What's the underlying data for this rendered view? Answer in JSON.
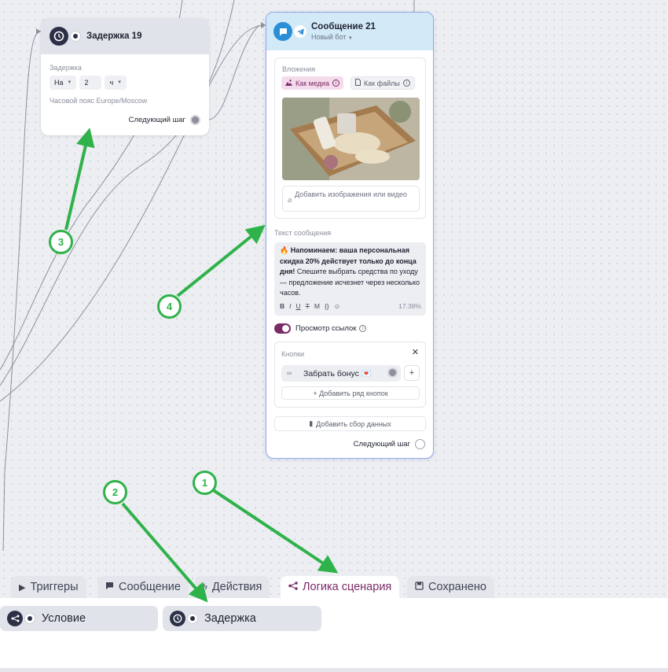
{
  "delay_node": {
    "title": "Задержка 19",
    "label": "Задержка",
    "select_mode": "На",
    "amount": "2",
    "unit": "ч",
    "timezone": "Часовой пояс Europe/Moscow",
    "next_step": "Следующий шаг"
  },
  "message_node": {
    "title": "Сообщение 21",
    "bot": "Новый бот",
    "attachments_label": "Вложения",
    "as_media": "Как медиа",
    "as_files": "Как файлы",
    "add_media": "Добавить изображения или видео",
    "text_label": "Текст сообщения",
    "text_emoji": "🔥",
    "text_bold": "Напоминаем: ваша персональная скидка 20% действует только до конца дня!",
    "text_rest": " Спешите выбрать средства по уходу — предложение исчезнет через несколько часов.",
    "format_buttons": [
      "B",
      "I",
      "U",
      "T",
      "M",
      "{}",
      "☺"
    ],
    "char_percent": "17.38%",
    "link_preview": "Просмотр ссылок",
    "buttons_label": "Кнопки",
    "bonus_button": "Забрать бонус 💌",
    "add_button_row": "+ Добавить ряд кнопок",
    "add_data_collection": "Добавить сбор данных",
    "next_step": "Следующий шаг"
  },
  "tabs": [
    {
      "label": "Триггеры",
      "icon": "play-icon"
    },
    {
      "label": "Сообщение",
      "icon": "chat-icon"
    },
    {
      "label": "Действия",
      "icon": "bolt-icon"
    },
    {
      "label": "Логика сценария",
      "icon": "branch-icon"
    },
    {
      "label": "Сохранено",
      "icon": "save-icon"
    }
  ],
  "active_tab": "Логика сценария",
  "blocks": [
    {
      "label": "Условие",
      "icon": "branch-icon"
    },
    {
      "label": "Задержка",
      "icon": "clock-icon"
    }
  ],
  "annotations": [
    "1",
    "2",
    "3",
    "4"
  ],
  "colors": {
    "accent": "#7a2a66",
    "marker": "#2fb24a",
    "telegram": "#2a8fd6"
  }
}
